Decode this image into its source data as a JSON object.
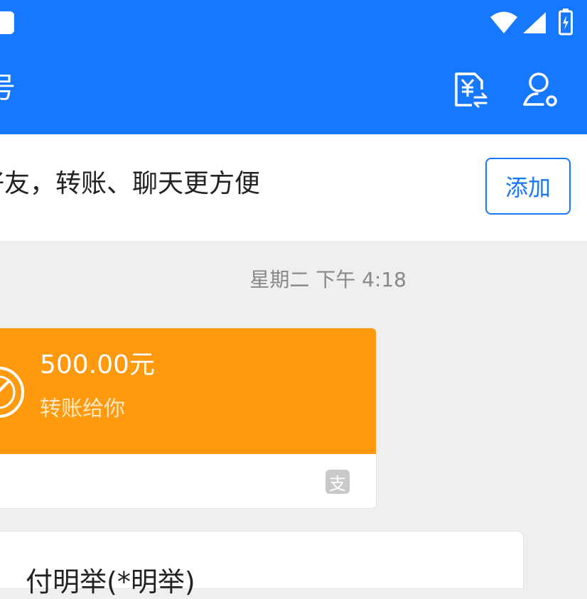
{
  "header": {
    "title_partial": "号",
    "transfer_icon": "yuan-transfer-icon",
    "profile_icon": "person-settings-icon"
  },
  "banner": {
    "text": "好友，转账、聊天更方便",
    "add_label": "添加"
  },
  "chat": {
    "timestamp": "星期二 下午 4:18",
    "transfer": {
      "amount": "500.00元",
      "label": "转账给你",
      "footer_icon": "支"
    },
    "next_message": "付明举(*明举)"
  },
  "colors": {
    "primary": "#1677ff",
    "transfer_orange": "#ff9a0e"
  }
}
